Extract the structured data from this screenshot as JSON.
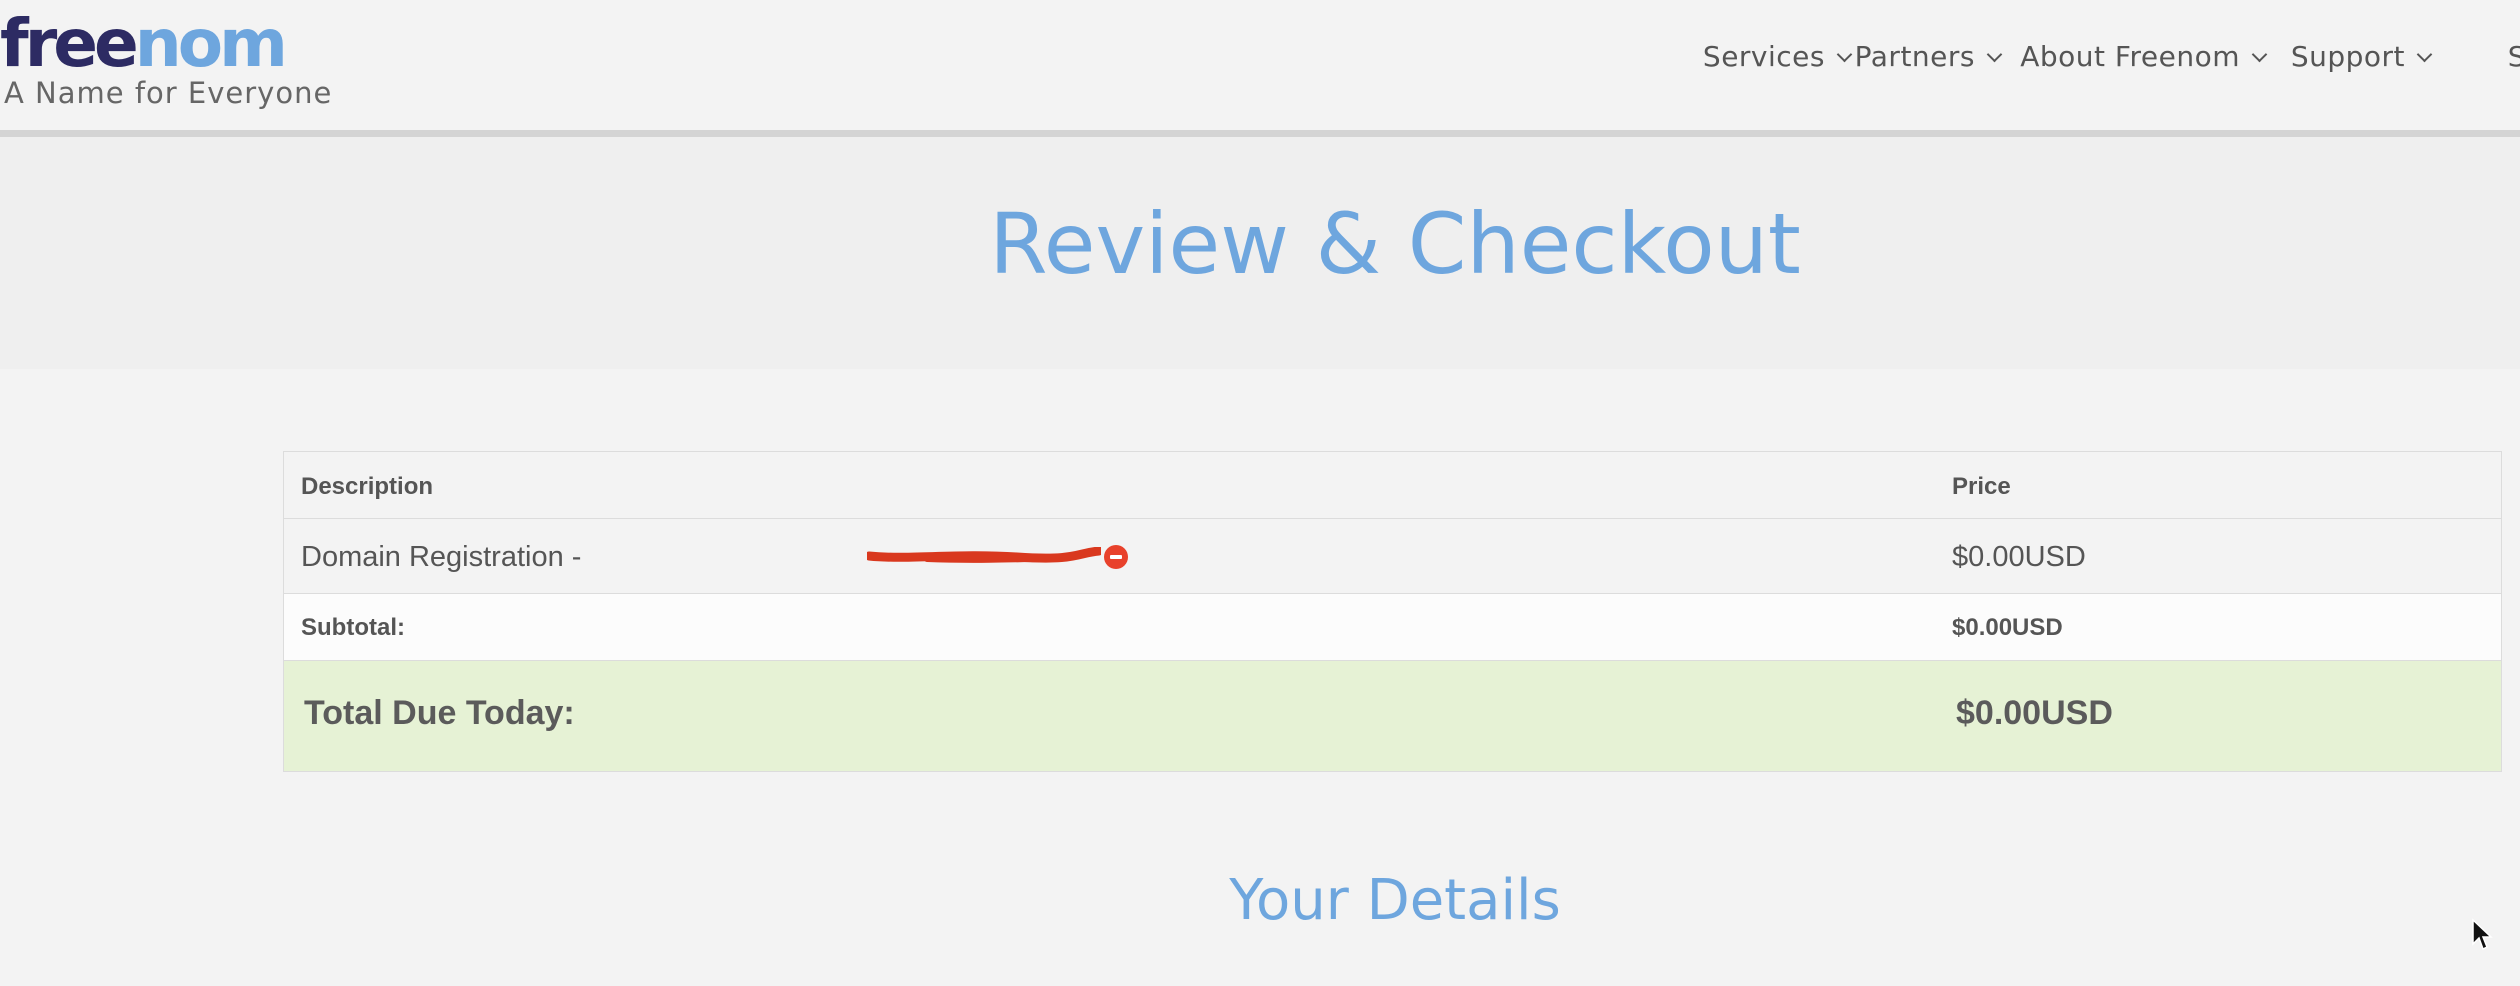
{
  "brand": {
    "logo_part1": "free",
    "logo_part2": "nom",
    "tagline": "A Name for Everyone",
    "colors": {
      "dark": "#2d2b63",
      "light": "#6ea6de"
    }
  },
  "nav": {
    "items": [
      {
        "label": "Services",
        "icon": "chevron-down-icon"
      },
      {
        "label": "Partners",
        "icon": "chevron-down-icon"
      },
      {
        "label": "About Freenom",
        "icon": "chevron-down-icon"
      },
      {
        "label": "Support",
        "icon": "chevron-down-icon"
      },
      {
        "label": "S"
      }
    ]
  },
  "hero": {
    "title": "Review & Checkout"
  },
  "cart": {
    "headers": {
      "description": "Description",
      "price": "Price"
    },
    "item": {
      "description": "Domain Registration -",
      "price": "$0.00USD",
      "remove_icon": "remove-circle-icon"
    },
    "subtotal": {
      "label": "Subtotal:",
      "value": "$0.00USD"
    },
    "total": {
      "label": "Total Due Today:",
      "value": "$0.00USD",
      "background": "#e6f2d5"
    }
  },
  "details": {
    "title": "Your Details"
  }
}
